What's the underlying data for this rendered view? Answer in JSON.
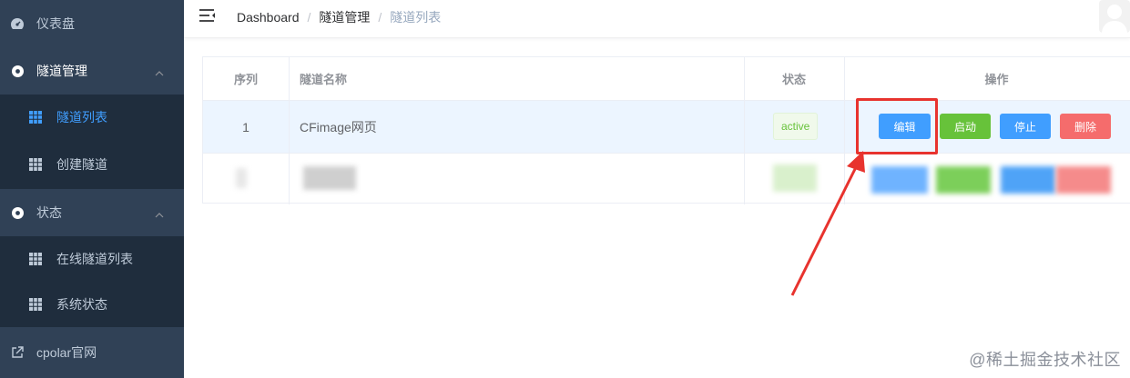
{
  "sidebar": {
    "items": [
      {
        "label": "仪表盘",
        "icon": "dashboard-icon"
      },
      {
        "label": "隧道管理",
        "icon": "circle-icon",
        "expanded": true,
        "children": [
          {
            "label": "隧道列表",
            "icon": "grid-icon",
            "active": true
          },
          {
            "label": "创建隧道",
            "icon": "grid-icon"
          }
        ]
      },
      {
        "label": "状态",
        "icon": "circle-icon",
        "expanded": true,
        "children": [
          {
            "label": "在线隧道列表",
            "icon": "grid-icon"
          },
          {
            "label": "系统状态",
            "icon": "grid-icon"
          }
        ]
      },
      {
        "label": "cpolar官网",
        "icon": "external-link-icon"
      }
    ]
  },
  "header": {
    "breadcrumb": [
      "Dashboard",
      "隧道管理",
      "隧道列表"
    ],
    "separator": "/"
  },
  "table": {
    "columns": [
      "序列",
      "隧道名称",
      "状态",
      "操作"
    ],
    "rows": [
      {
        "index": "1",
        "name": "CFimage网页",
        "status": "active",
        "actions": {
          "edit": "编辑",
          "start": "启动",
          "stop": "停止",
          "delete": "删除"
        }
      }
    ]
  },
  "watermark": "@稀土掘金技术社区",
  "colors": {
    "sidebar_bg": "#304156",
    "submenu_bg": "#1f2d3d",
    "active": "#409eff",
    "edit": "#409eff",
    "start": "#67c23a",
    "stop": "#409eff",
    "delete": "#f56c6c",
    "highlight": "#e8332e"
  }
}
